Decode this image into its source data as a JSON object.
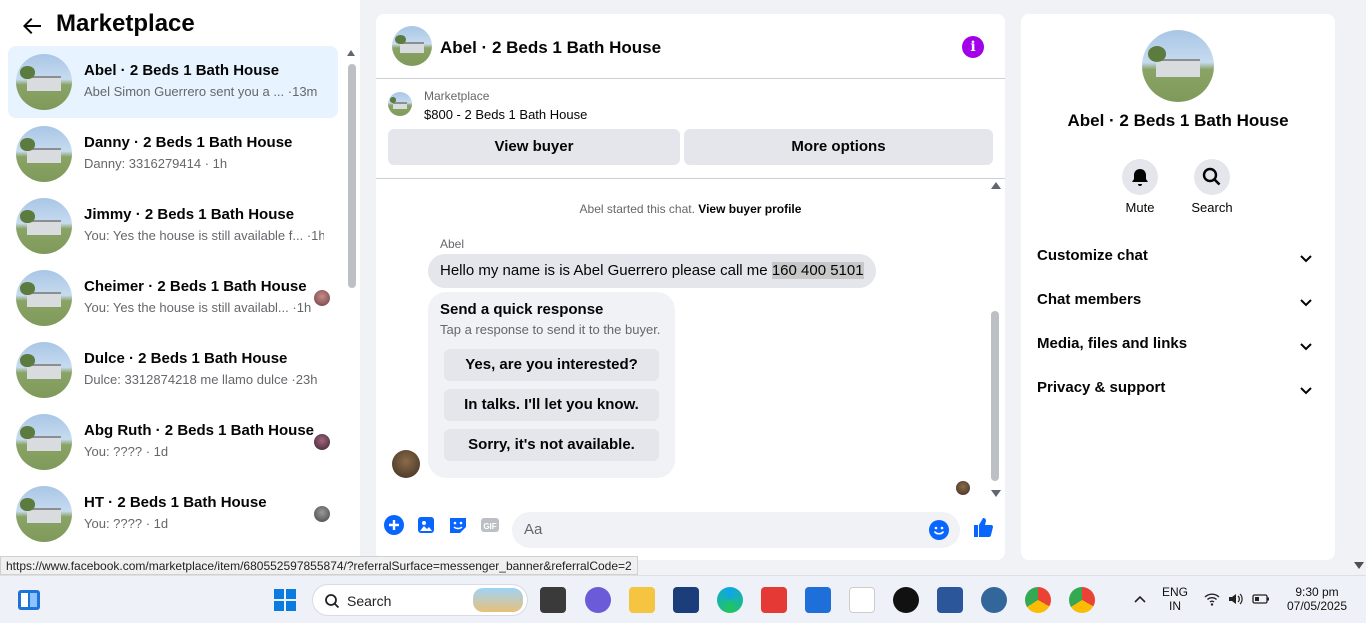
{
  "sidebar": {
    "title": "Marketplace",
    "conversations": [
      {
        "title": "Abel · 2 Beds 1 Bath House",
        "preview": "Abel Simon Guerrero sent you a ... ·13m"
      },
      {
        "title": "Danny · 2 Beds 1 Bath House",
        "preview": "Danny: 3316279414 · 1h"
      },
      {
        "title": "Jimmy · 2 Beds 1 Bath House",
        "preview": "You: Yes the house is still available f... ·1h"
      },
      {
        "title": "Cheimer · 2 Beds 1 Bath House",
        "preview": "You: Yes the house is still availabl... ·1h"
      },
      {
        "title": "Dulce · 2 Beds 1 Bath House",
        "preview": "Dulce: 3312874218 me llamo dulce ·23h"
      },
      {
        "title": "Abg Ruth · 2 Beds 1 Bath House",
        "preview": "You: ???? · 1d"
      },
      {
        "title": "HT · 2 Beds 1 Bath House",
        "preview": "You: ???? · 1d"
      }
    ]
  },
  "chat": {
    "title": "Abel · 2 Beds 1 Bath House",
    "listing_source": "Marketplace",
    "listing_price_title": "$800 - 2 Beds 1 Bath House",
    "view_buyer": "View buyer",
    "more_options": "More options",
    "start_note_prefix": "Abel started this chat.",
    "start_note_link": "View buyer profile",
    "sender": "Abel",
    "message_text": "Hello my name is is Abel Guerrero please call me ",
    "message_highlight": "160 400 5101",
    "quick_title": "Send a quick response",
    "quick_sub": "Tap a response to send it to the buyer.",
    "quick_options": [
      "Yes, are you interested?",
      "In talks. I'll let you know.",
      "Sorry, it's not available."
    ],
    "composer_placeholder": "Aa"
  },
  "info_panel": {
    "name": "Abel · 2 Beds 1 Bath House",
    "mute": "Mute",
    "search": "Search",
    "sections": [
      "Customize chat",
      "Chat members",
      "Media, files and links",
      "Privacy & support"
    ]
  },
  "status_url": "https://www.facebook.com/marketplace/item/680552597855874/?referralSurface=messenger_banner&referralCode=2",
  "taskbar": {
    "search_label": "Search",
    "lang_line1": "ENG",
    "lang_line2": "IN",
    "time": "9:30 pm",
    "date": "07/05/2025"
  },
  "colors": {
    "accent": "#0866ff",
    "info": "#a100e8",
    "active_row": "#e7f3ff"
  }
}
